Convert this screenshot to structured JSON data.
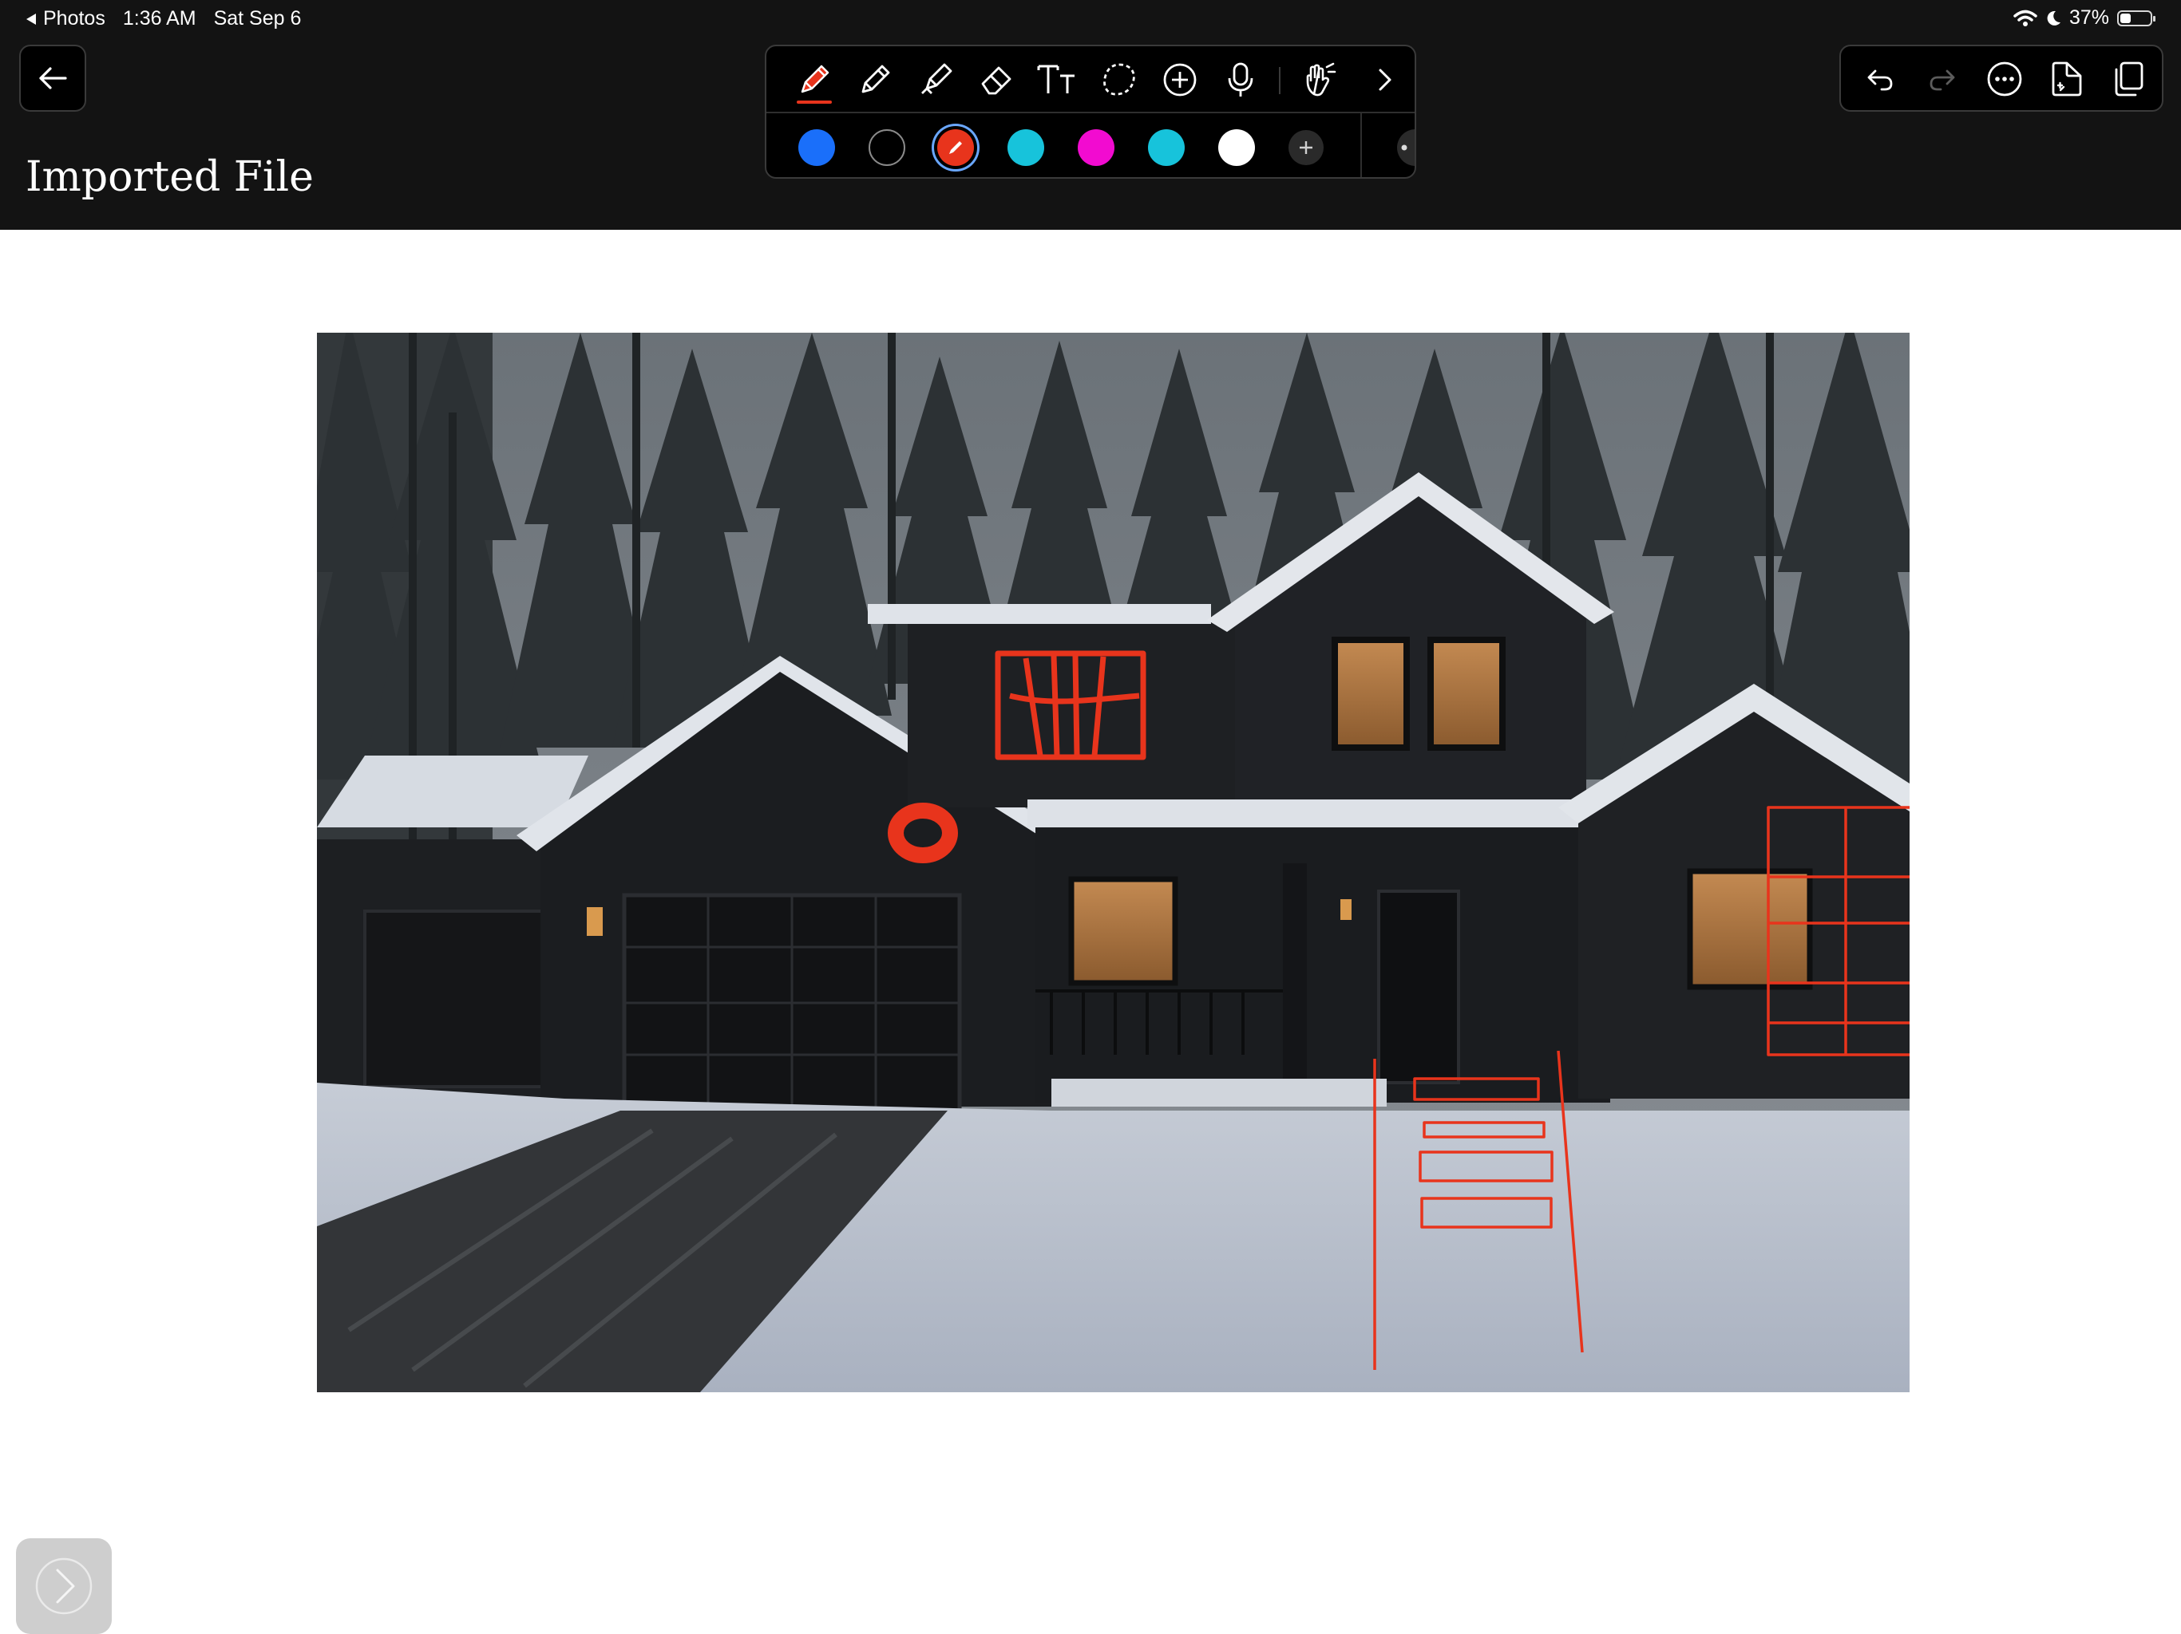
{
  "status_bar": {
    "back_app": "Photos",
    "time": "1:36 AM",
    "date": "Sat Sep 6",
    "battery": "37%",
    "battery_level": 0.37
  },
  "document": {
    "title": "Imported File"
  },
  "toolbar": {
    "tools": [
      "pen-icon",
      "pencil-icon",
      "highlighter-icon",
      "eraser-icon",
      "text-tool-icon",
      "lasso-icon",
      "add-shape-icon",
      "microphone-icon",
      "touch-gesture-icon",
      "chevron-right-icon"
    ],
    "active_tool": "pen",
    "colors": [
      "#1a6ffa",
      "#000000",
      "#e8341c",
      "#17c3db",
      "#f20bd0",
      "#17c3db",
      "#ffffff"
    ],
    "selected_color": "#e8341c"
  },
  "right_toolbar": {
    "items": [
      "undo-icon",
      "redo-icon",
      "more-icon",
      "export-icon",
      "pages-icon"
    ]
  },
  "canvas": {
    "image": "snowy dark house in pine forest with red pen annotations",
    "annotation_color": "#e8341c"
  }
}
